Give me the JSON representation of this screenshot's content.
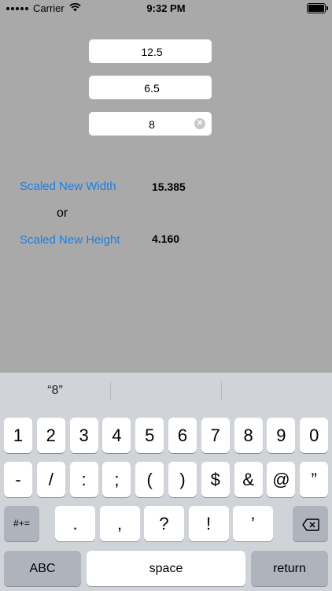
{
  "status": {
    "carrier": "Carrier",
    "time": "9:32 PM"
  },
  "inputs": {
    "width": "12.5",
    "height": "6.5",
    "target": "8"
  },
  "results": {
    "width_label": "Scaled New Width",
    "width_value": "15.385",
    "or": "or",
    "height_label": "Scaled New Height",
    "height_value": "4.160"
  },
  "keyboard": {
    "suggestion": "“8”",
    "row1": [
      "1",
      "2",
      "3",
      "4",
      "5",
      "6",
      "7",
      "8",
      "9",
      "0"
    ],
    "row2": [
      "-",
      "/",
      ":",
      ";",
      "(",
      ")",
      "$",
      "&",
      "@",
      "”"
    ],
    "symbols_key": "#+=",
    "row3": [
      ".",
      ",",
      "?",
      "!",
      "’"
    ],
    "abc": "ABC",
    "space": "space",
    "return": "return"
  }
}
